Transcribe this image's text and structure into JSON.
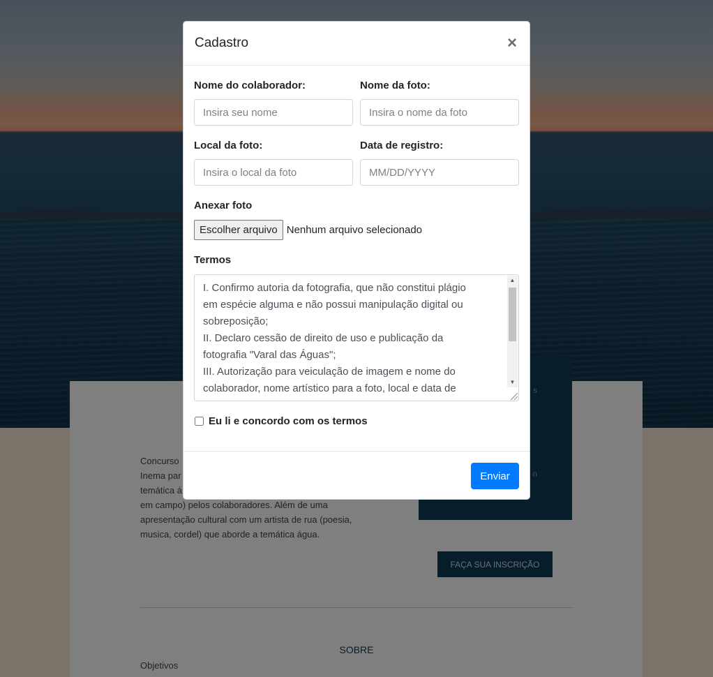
{
  "background": {
    "description_lines": [
      "Concurso",
      "Inema par",
      "temática á",
      "em campo) pelos colaboradores. Além de uma",
      "apresentação cultural com um artista de rua (poesia,",
      "musica, cordel) que aborde a temática água."
    ],
    "dark_box_fragments": [
      "s",
      "n"
    ],
    "cta_label": "FAÇA SUA INSCRIÇÃO",
    "section_title": "SOBRE",
    "section_subtitle": "Objetivos"
  },
  "modal": {
    "title": "Cadastro",
    "close_symbol": "×",
    "fields": {
      "collaborator_label": "Nome do colaborador:",
      "collaborator_placeholder": "Insira seu nome",
      "photo_name_label": "Nome da foto:",
      "photo_name_placeholder": "Insira o nome da foto",
      "location_label": "Local da foto:",
      "location_placeholder": "Insira o local da foto",
      "date_label": "Data de registro:",
      "date_placeholder": "MM/DD/YYYY"
    },
    "attach": {
      "label": "Anexar foto",
      "button": "Escolher arquivo",
      "status": "Nenhum arquivo selecionado"
    },
    "terms": {
      "label": "Termos",
      "lines": [
        "I. Confirmo autoria da fotografia, que não constitui plágio",
        "em espécie alguma e não possui manipulação digital ou",
        "sobreposição;",
        "II. Declaro cessão de direito de uso e publicação da",
        "fotografia \"Varal das Águas\";",
        "III. Autorização para veiculação de imagem e nome do",
        "colaborador, nome artístico para a foto, local e data de"
      ]
    },
    "agree_label": "Eu li e concordo com os termos",
    "submit_label": "Enviar"
  }
}
